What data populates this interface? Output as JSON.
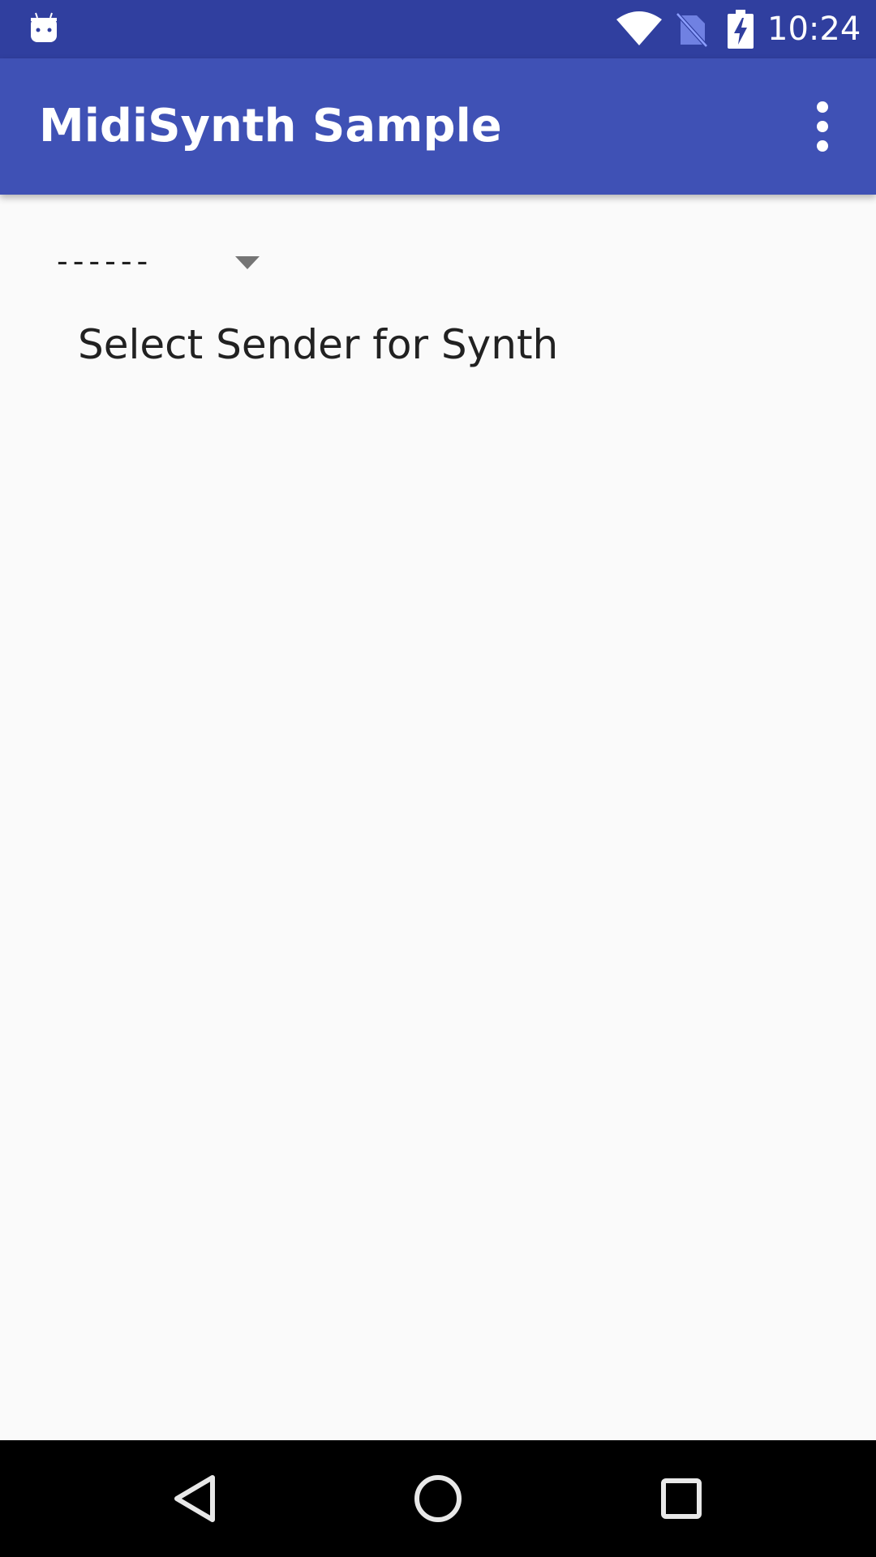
{
  "status_bar": {
    "time": "10:24",
    "icons": [
      "android-notification-icon",
      "wifi-icon",
      "no-sim-icon",
      "battery-charging-icon"
    ],
    "background": "#303f9f"
  },
  "app_bar": {
    "title": "MidiSynth Sample",
    "overflow_icon": "more-vert-icon",
    "background": "#3f51b5"
  },
  "main": {
    "sender_spinner": {
      "selected_value": "------",
      "icon": "dropdown-arrow-icon"
    },
    "label": "Select Sender for Synth"
  },
  "nav_bar": {
    "buttons": [
      "back-icon",
      "home-icon",
      "recents-icon"
    ]
  }
}
